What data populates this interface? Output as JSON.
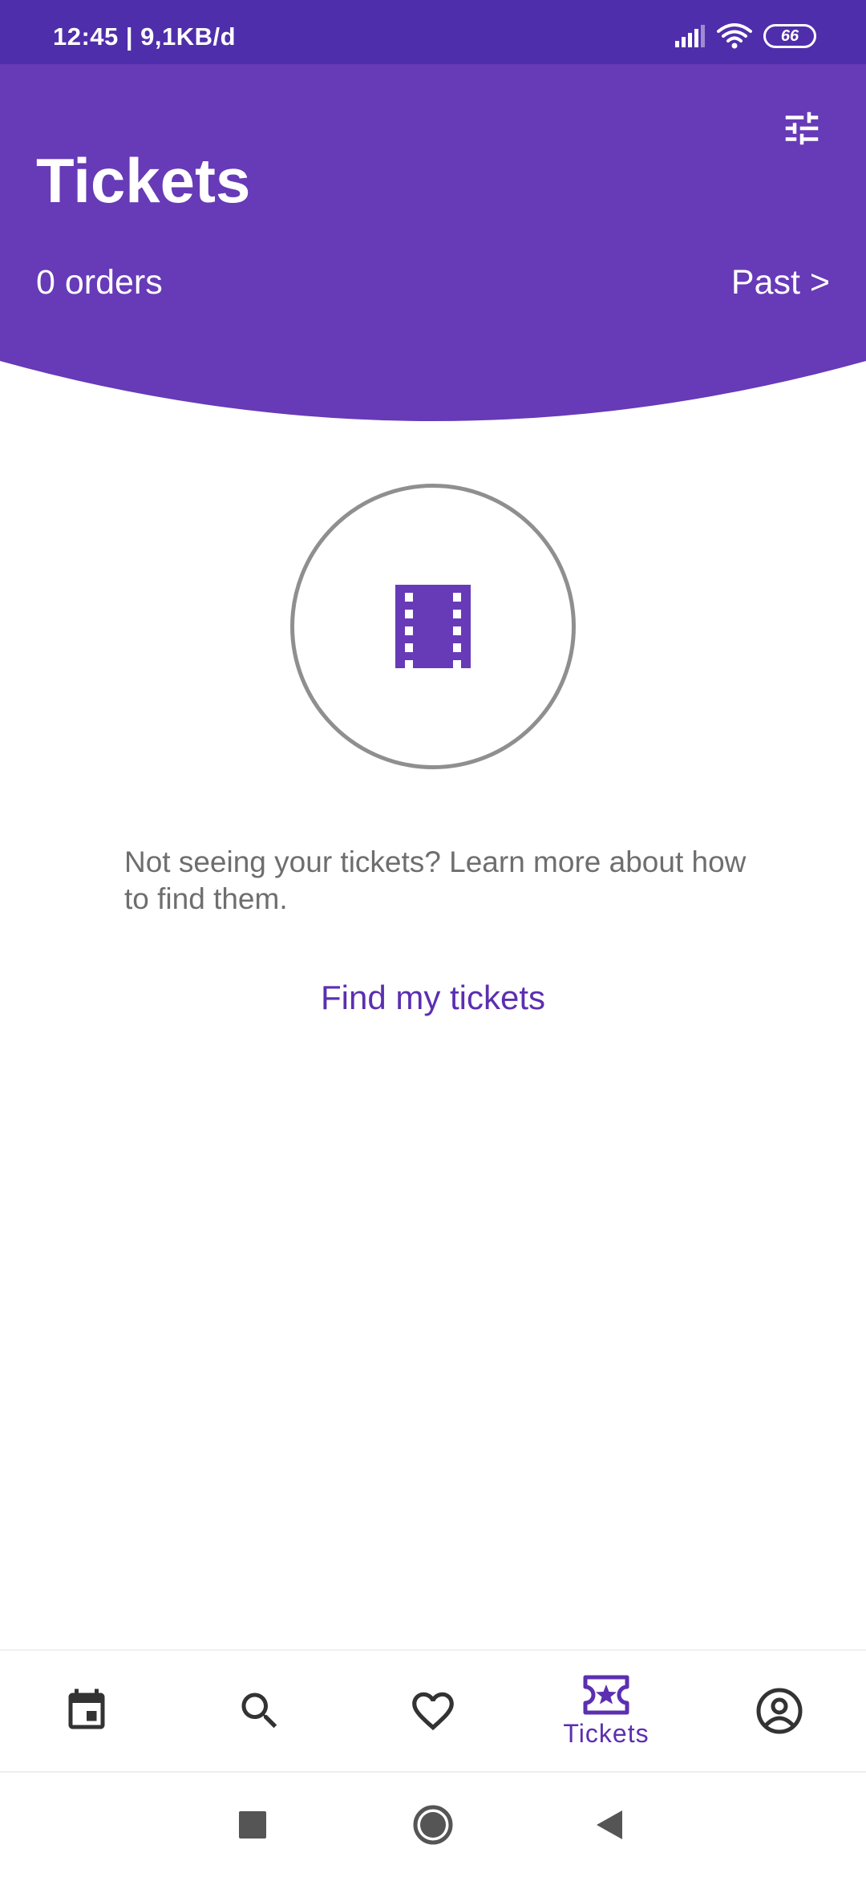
{
  "status_bar": {
    "time_and_speed": "12:45 | 9,1KB/d",
    "battery_level": "66",
    "icons": [
      "signal-icon",
      "wifi-icon",
      "battery-icon"
    ]
  },
  "header": {
    "title": "Tickets",
    "orders_count": "0 orders",
    "past_link": "Past >",
    "filter_icon": "tune-icon"
  },
  "empty_state": {
    "icon": "film-strip-icon",
    "message": "Not seeing your tickets? Learn more about how to find them.",
    "action_label": "Find my tickets"
  },
  "bottom_nav": {
    "items": [
      {
        "icon": "calendar-icon",
        "label": ""
      },
      {
        "icon": "search-icon",
        "label": ""
      },
      {
        "icon": "heart-icon",
        "label": ""
      },
      {
        "icon": "ticket-icon",
        "label": "Tickets",
        "active": true
      },
      {
        "icon": "account-icon",
        "label": ""
      }
    ]
  },
  "system_nav": {
    "buttons": [
      "recents-icon",
      "home-icon",
      "back-icon"
    ]
  },
  "colors": {
    "status_bar": "#4f2eab",
    "header": "#673ab7",
    "accent": "#5b2fb0",
    "muted_text": "#6e6e6e",
    "circle_border": "#8f8f8f",
    "nav_icon": "#333333"
  }
}
